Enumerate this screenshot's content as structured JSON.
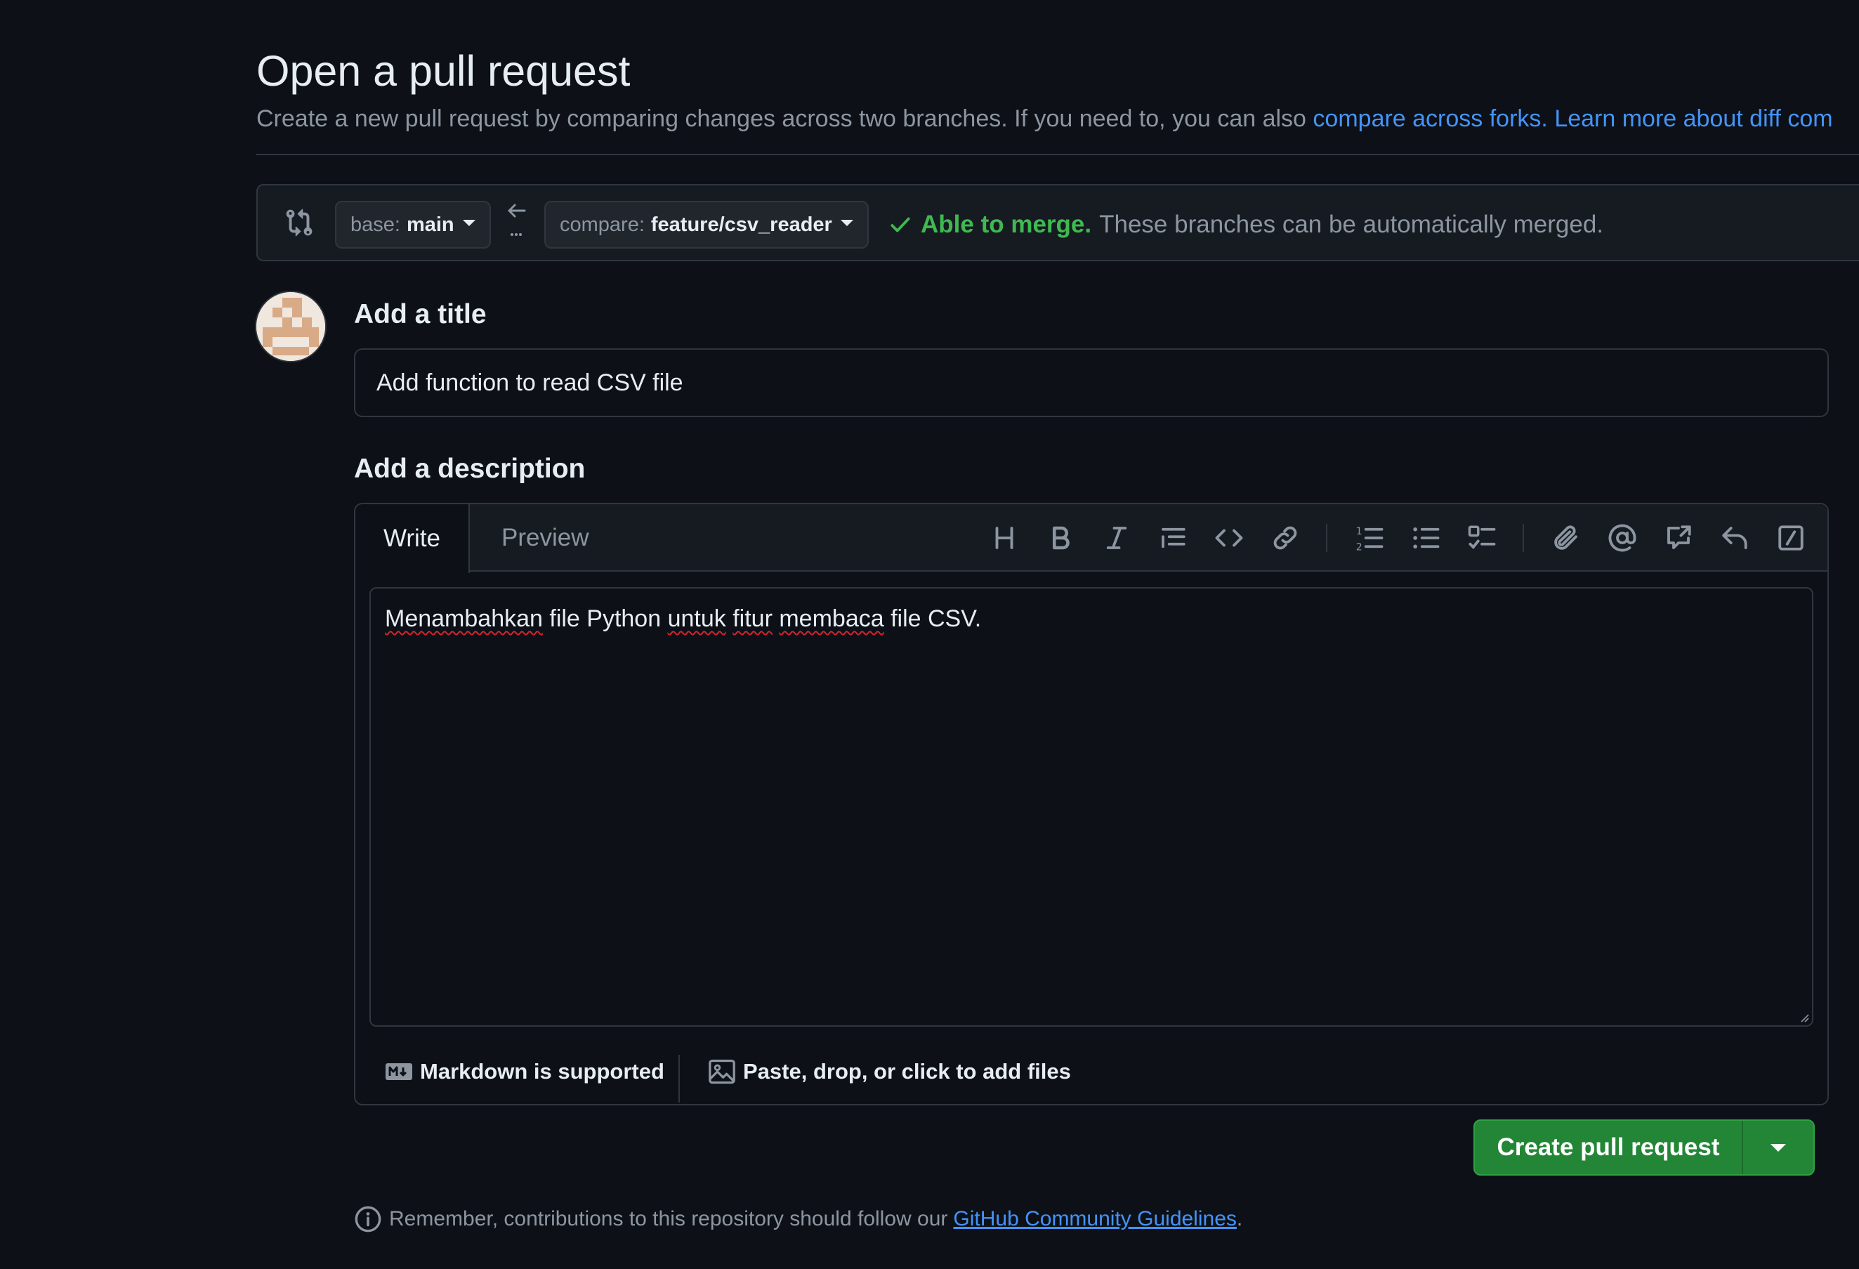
{
  "page": {
    "title": "Open a pull request",
    "subtitle_text": "Create a new pull request by comparing changes across two branches. If you need to, you can also ",
    "subtitle_link1": "compare across forks.",
    "subtitle_link2": "Learn more about diff com"
  },
  "range": {
    "base_prefix": "base:",
    "base_branch": "main",
    "compare_prefix": "compare:",
    "compare_branch": "feature/csv_reader",
    "merge_status": "Able to merge.",
    "merge_detail": "These branches can be automatically merged.",
    "colors": {
      "success": "#3fb950"
    }
  },
  "form": {
    "title_heading": "Add a title",
    "title_value": "Add function to read CSV file",
    "description_heading": "Add a description",
    "tabs": [
      "Write",
      "Preview"
    ],
    "toolbar_icons": [
      "heading-icon",
      "bold-icon",
      "italic-icon",
      "quote-icon",
      "code-icon",
      "link-icon",
      "numbered-list-icon",
      "unordered-list-icon",
      "task-list-icon",
      "attach-icon",
      "mention-icon",
      "cross-reference-icon",
      "reply-icon",
      "slash-commands-icon"
    ],
    "body_words": {
      "w1": "Menambahkan",
      "w2": " file Python ",
      "w3": "untuk",
      "w4": " ",
      "w5": "fitur",
      "w6": " ",
      "w7": "membaca",
      "w8": " file CSV."
    },
    "markdown_note": "Markdown is supported",
    "files_note": "Paste, drop, or click to add files"
  },
  "actions": {
    "create_label": "Create pull request",
    "colors": {
      "primary": "#238636"
    }
  },
  "footer": {
    "note_text": "Remember, contributions to this repository should follow our",
    "note_link": "GitHub Community Guidelines",
    "note_end": "."
  }
}
